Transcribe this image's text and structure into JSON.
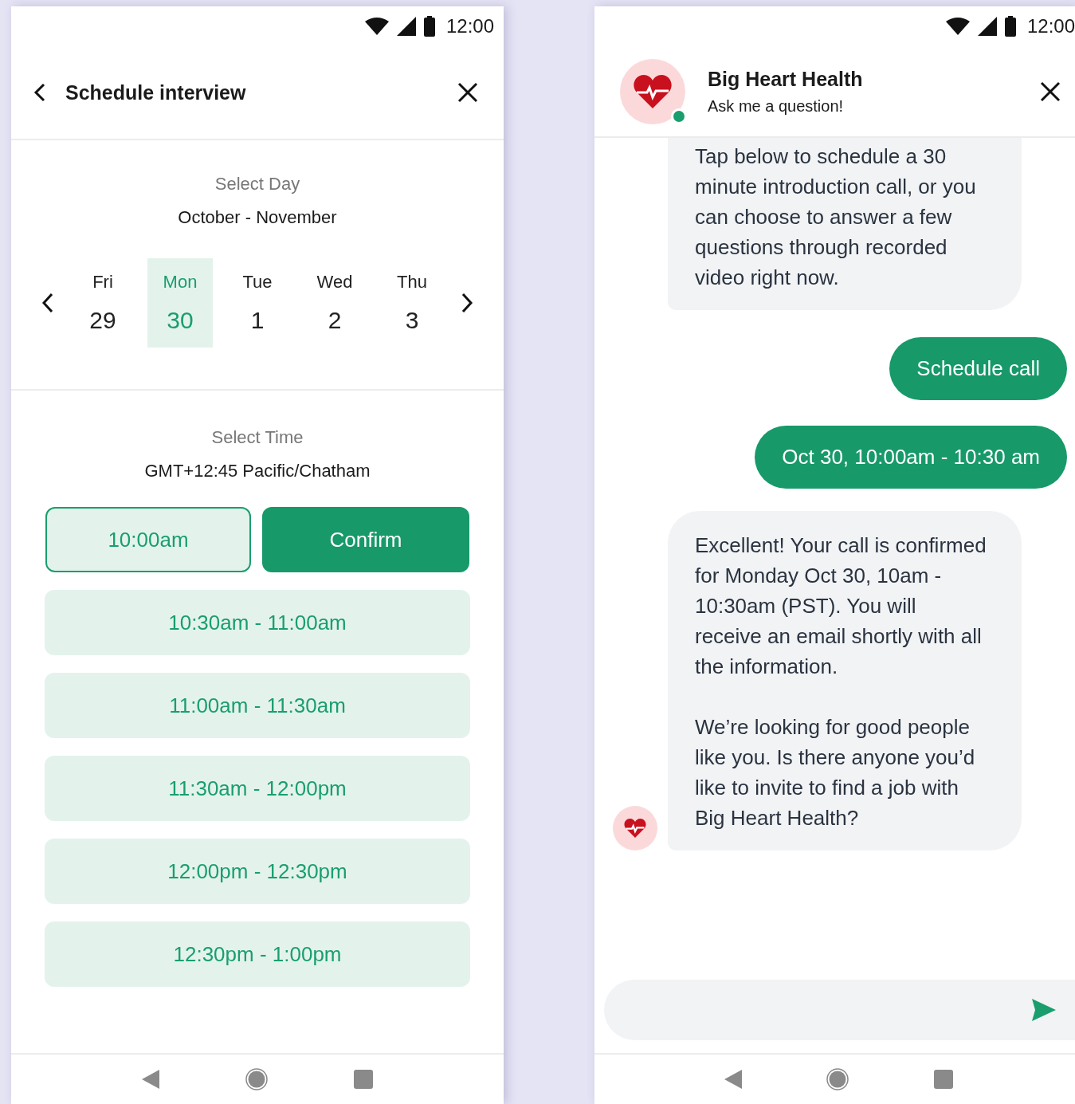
{
  "left_screen": {
    "status_bar": {
      "time": "12:00"
    },
    "header": {
      "title": "Schedule interview"
    },
    "day_picker": {
      "label": "Select Day",
      "range": "October - November",
      "days": [
        {
          "weekday": "Fri",
          "date": "29",
          "selected": false
        },
        {
          "weekday": "Mon",
          "date": "30",
          "selected": true
        },
        {
          "weekday": "Tue",
          "date": "1",
          "selected": false
        },
        {
          "weekday": "Wed",
          "date": "2",
          "selected": false
        },
        {
          "weekday": "Thu",
          "date": "3",
          "selected": false
        }
      ]
    },
    "time_picker": {
      "label": "Select Time",
      "timezone": "GMT+12:45 Pacific/Chatham",
      "selected_slot": "10:00am",
      "confirm_button": "Confirm",
      "slots": [
        "10:30am - 11:00am",
        "11:00am - 11:30am",
        "11:30am - 12:00pm",
        "12:00pm - 12:30pm",
        "12:30pm - 1:00pm"
      ]
    }
  },
  "right_screen": {
    "status_bar": {
      "time": "12:00"
    },
    "header": {
      "name": "Big Heart Health",
      "subtitle": "Ask me a question!",
      "online": true
    },
    "messages": [
      {
        "kind": "bot",
        "show_avatar": false,
        "paragraphs": [
          "Tap below to schedule a 30 minute introduction call, or you can choose to answer a few questions through recorded video right now."
        ]
      },
      {
        "kind": "user",
        "paragraphs": [
          "Schedule call"
        ]
      },
      {
        "kind": "user",
        "paragraphs": [
          "Oct 30, 10:00am - 10:30 am"
        ]
      },
      {
        "kind": "bot",
        "show_avatar": true,
        "paragraphs": [
          "Excellent! Your call is confirmed for Monday Oct 30, 10am - 10:30am (PST). You will receive an email shortly with all the information.",
          "We’re looking for good people like you. Is there anyone you’d like to invite to find a job with Big Heart Health?"
        ]
      }
    ]
  }
}
